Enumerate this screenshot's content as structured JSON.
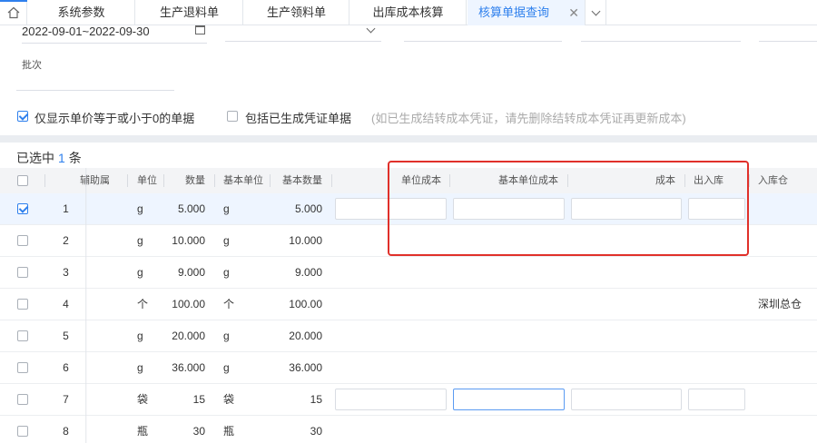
{
  "tabs": [
    {
      "label": "系统参数",
      "active": false
    },
    {
      "label": "生产退料单",
      "active": false
    },
    {
      "label": "生产领料单",
      "active": false
    },
    {
      "label": "出库成本核算",
      "active": false
    },
    {
      "label": "核算单据查询",
      "active": true
    }
  ],
  "filter": {
    "date_range": "2022-09-01~2022-09-30",
    "batch_label": "批次"
  },
  "options": {
    "show_price_le_zero": "仅显示单价等于或小于0的单据",
    "include_voucher": "包括已生成凭证单据",
    "hint": "(如已生成结转成本凭证，请先删除结转成本凭证再更新成本)"
  },
  "selection": {
    "prefix": "已选中",
    "count": "1",
    "suffix": "条"
  },
  "columns": {
    "aux_attr": "辅助属性",
    "unit": "单位",
    "qty": "数量",
    "base_unit": "基本单位",
    "base_qty": "基本数量",
    "unit_cost": "单位成本",
    "base_unit_cost": "基本单位成本",
    "cost": "成本",
    "in_out": "出入库",
    "warehouse": "入库仓"
  },
  "rows": [
    {
      "no": "1",
      "unit": "g",
      "qty": "5.000",
      "base_unit": "g",
      "base_qty": "5.000",
      "warehouse": "",
      "checked": true
    },
    {
      "no": "2",
      "unit": "g",
      "qty": "10.000",
      "base_unit": "g",
      "base_qty": "10.000",
      "warehouse": "",
      "checked": false
    },
    {
      "no": "3",
      "unit": "g",
      "qty": "9.000",
      "base_unit": "g",
      "base_qty": "9.000",
      "warehouse": "",
      "checked": false
    },
    {
      "no": "4",
      "unit": "个",
      "qty": "100.00",
      "base_unit": "个",
      "base_qty": "100.00",
      "warehouse": "深圳总仓",
      "checked": false
    },
    {
      "no": "5",
      "unit": "g",
      "qty": "20.000",
      "base_unit": "g",
      "base_qty": "20.000",
      "warehouse": "",
      "checked": false
    },
    {
      "no": "6",
      "unit": "g",
      "qty": "36.000",
      "base_unit": "g",
      "base_qty": "36.000",
      "warehouse": "",
      "checked": false
    },
    {
      "no": "7",
      "unit": "袋",
      "qty": "15",
      "base_unit": "袋",
      "base_qty": "15",
      "warehouse": "",
      "checked": false
    },
    {
      "no": "8",
      "unit": "瓶",
      "qty": "30",
      "base_unit": "瓶",
      "base_qty": "30",
      "warehouse": "",
      "checked": false
    }
  ],
  "colors": {
    "accent": "#2f80ed",
    "annotation": "#e0302a",
    "selected_row": "#eef5ff"
  }
}
